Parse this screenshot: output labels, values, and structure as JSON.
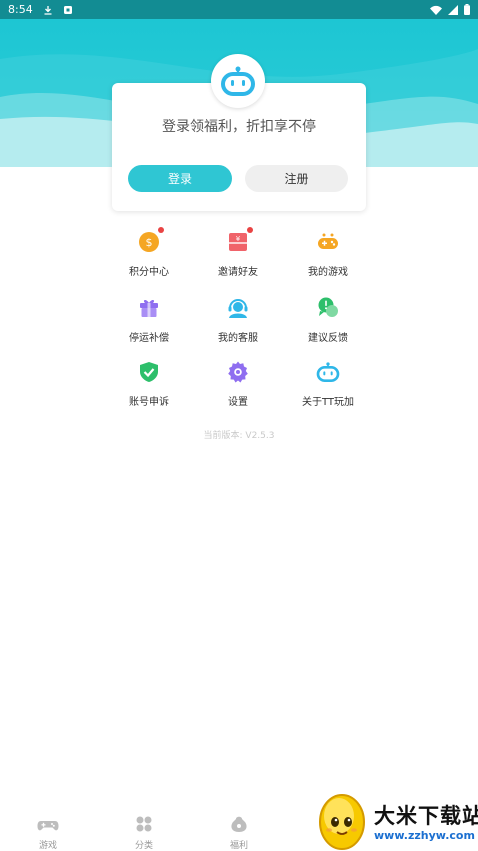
{
  "status_bar": {
    "time": "8:54"
  },
  "login_card": {
    "tip": "登录领福利，折扣享不停",
    "login_label": "登录",
    "register_label": "注册"
  },
  "menu": [
    {
      "label": "积分中心",
      "icon": "points-coin-icon",
      "color": "#f5a623",
      "badge": true
    },
    {
      "label": "邀请好友",
      "icon": "invite-envelope-icon",
      "color": "#f0636a",
      "badge": true
    },
    {
      "label": "我的游戏",
      "icon": "gamepad-icon",
      "color": "#f5a623",
      "badge": false
    },
    {
      "label": "停运补偿",
      "icon": "gift-icon",
      "color": "#8f6ef0",
      "badge": false
    },
    {
      "label": "我的客服",
      "icon": "customer-service-icon",
      "color": "#2fb7e8",
      "badge": false
    },
    {
      "label": "建议反馈",
      "icon": "feedback-chat-icon",
      "color": "#2dbf6b",
      "badge": false
    },
    {
      "label": "账号申诉",
      "icon": "shield-check-icon",
      "color": "#2dbf6b",
      "badge": false
    },
    {
      "label": "设置",
      "icon": "settings-gear-icon",
      "color": "#8f6ef0",
      "badge": false
    },
    {
      "label": "关于TT玩加",
      "icon": "robot-logo-icon",
      "color": "#2fb7e8",
      "badge": false
    }
  ],
  "version": "当前版本: V2.5.3",
  "bottom_nav": [
    {
      "label": "游戏",
      "icon": "gamepad-icon"
    },
    {
      "label": "分类",
      "icon": "category-grid-icon"
    },
    {
      "label": "福利",
      "icon": "gift-bag-icon"
    }
  ],
  "watermark": {
    "title": "大米下载站",
    "url": "www.zzhyw.com"
  },
  "colors": {
    "accent": "#2fc6d3",
    "header": "#1dc6d3",
    "status_bar": "#128c93"
  }
}
